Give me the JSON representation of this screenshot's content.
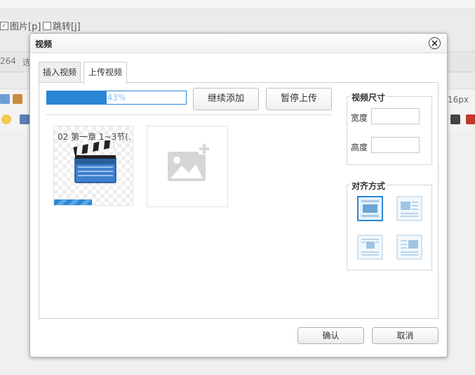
{
  "background": {
    "options": [
      {
        "label": "图片[p]",
        "checked": true
      },
      {
        "label": "跳转[j]",
        "checked": false
      }
    ],
    "row_fragments": [
      "264",
      "选"
    ],
    "font_size_value": "16px"
  },
  "dialog": {
    "title": "视频",
    "tabs": [
      {
        "label": "插入视频",
        "active": false
      },
      {
        "label": "上传视频",
        "active": true
      }
    ],
    "upload": {
      "progress_percent": 43,
      "progress_label": "43%",
      "continue_add_label": "继续添加",
      "pause_upload_label": "暂停上传",
      "file": {
        "name": "02 第一章 1~3节(...",
        "upload_progress_percent": 48
      }
    },
    "video_size": {
      "legend": "视频尺寸",
      "width_label": "宽度",
      "height_label": "高度",
      "width_value": "",
      "height_value": ""
    },
    "alignment": {
      "legend": "对齐方式",
      "options": [
        "none",
        "left",
        "center",
        "right"
      ],
      "selected": "none"
    },
    "confirm_label": "确认",
    "cancel_label": "取消"
  },
  "colors": {
    "accent": "#2c86d6",
    "progress_text": "#8bc0ef"
  }
}
